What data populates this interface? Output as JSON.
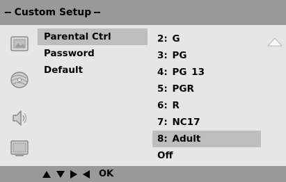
{
  "title_bar": {
    "dash_left": "--",
    "title": "Custom Setup",
    "dash_right": "--"
  },
  "side_icons": [
    "picture-icon",
    "disc-icon",
    "audio-icon",
    "screen-icon"
  ],
  "menu": {
    "items": [
      {
        "label": "Parental Ctrl",
        "active": true
      },
      {
        "label": "Password",
        "active": false
      },
      {
        "label": "Default",
        "active": false
      }
    ]
  },
  "options": [
    {
      "num": "2:",
      "label": "G"
    },
    {
      "num": "3:",
      "label": "PG"
    },
    {
      "num": "4:",
      "label": "PG 13"
    },
    {
      "num": "5:",
      "label": "PGR"
    },
    {
      "num": "6:",
      "label": "R"
    },
    {
      "num": "7:",
      "label": "NC17"
    },
    {
      "num": "8:",
      "label": "Adult",
      "selected": true
    },
    {
      "num": "",
      "label": "Off"
    }
  ],
  "bottom_bar": {
    "ok_label": "OK"
  },
  "colors": {
    "bar": "#999999",
    "panel": "#e6e6e6",
    "highlight": "#bdbdbd"
  }
}
